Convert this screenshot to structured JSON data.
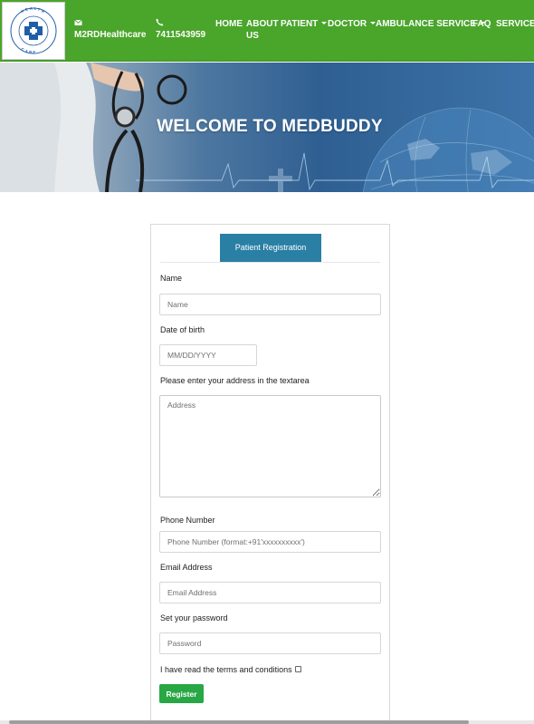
{
  "header": {
    "logo": {
      "ring_text": "HEALTHCARE",
      "cross_color": "#1f5fa8"
    },
    "contact": {
      "email_icon": "envelope-icon",
      "email_text": "M2RDHealthcare",
      "phone_icon": "phone-icon",
      "phone_text": "7411543959"
    },
    "nav": [
      {
        "label": "HOME",
        "dropdown": false
      },
      {
        "label": "ABOUT US",
        "dropdown": false
      },
      {
        "label": "PATIENT",
        "dropdown": true
      },
      {
        "label": "DOCTOR",
        "dropdown": true
      },
      {
        "label": "AMBULANCE SERVICE",
        "dropdown": true
      },
      {
        "label": "FAQ",
        "dropdown": false
      },
      {
        "label": "SERVICES",
        "dropdown": false
      }
    ],
    "colors": {
      "navbar_bg": "#4aa52b",
      "text": "#ffffff"
    }
  },
  "hero": {
    "title": "WELCOME TO MEDBUDDY"
  },
  "form": {
    "active_tab": "Patient Registration",
    "fields": {
      "name": {
        "label": "Name",
        "placeholder": "Name",
        "value": ""
      },
      "dob": {
        "label": "Date of birth",
        "placeholder": "MM/DD/YYYY",
        "value": ""
      },
      "address": {
        "label": "Please enter your address in the textarea",
        "placeholder": "Address",
        "value": ""
      },
      "phone": {
        "label": "Phone Number",
        "placeholder": "Phone Number (format:+91'xxxxxxxxxx')",
        "value": ""
      },
      "email": {
        "label": "Email Address",
        "placeholder": "Email Address",
        "value": ""
      },
      "password": {
        "label": "Set your password",
        "placeholder": "Password",
        "value": ""
      }
    },
    "terms_label": "I have read the terms and conditions",
    "terms_checked": false,
    "submit_label": "Register",
    "colors": {
      "tab_active_bg": "#2a7fa5",
      "submit_bg": "#28a745"
    }
  }
}
